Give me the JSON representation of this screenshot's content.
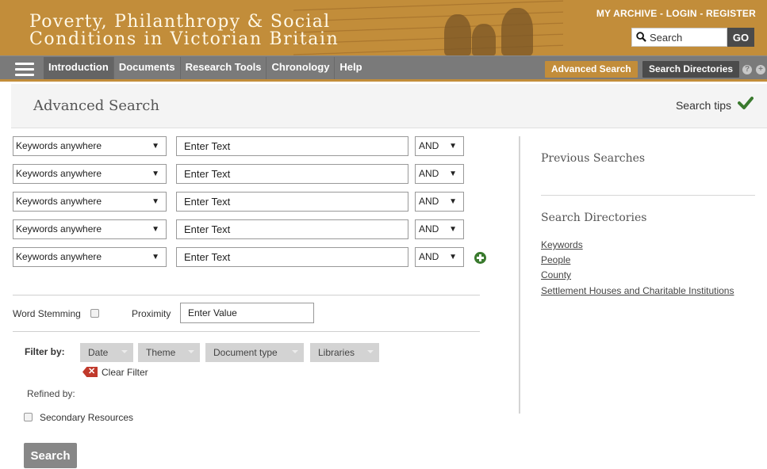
{
  "header": {
    "title_line1": "Poverty, Philanthropy & Social",
    "title_line2": "Conditions in Victorian Britain",
    "top_links": {
      "my_archive": "MY ARCHIVE",
      "login": "LOGIN",
      "register": "REGISTER",
      "separator": " - "
    },
    "search_placeholder": "Search",
    "go_label": "GO"
  },
  "nav": {
    "items": [
      {
        "label": "Introduction"
      },
      {
        "label": "Documents"
      },
      {
        "label": "Research Tools"
      },
      {
        "label": "Chronology"
      },
      {
        "label": "Help"
      }
    ],
    "advanced_search": "Advanced Search",
    "search_directories": "Search Directories",
    "help_icon_glyph": "?",
    "add_icon_glyph": "+"
  },
  "page": {
    "title": "Advanced Search",
    "search_tips": "Search tips"
  },
  "search_rows": [
    {
      "field": "Keywords anywhere",
      "placeholder": "Enter Text",
      "operator": "AND"
    },
    {
      "field": "Keywords anywhere",
      "placeholder": "Enter Text",
      "operator": "AND"
    },
    {
      "field": "Keywords anywhere",
      "placeholder": "Enter Text",
      "operator": "AND"
    },
    {
      "field": "Keywords anywhere",
      "placeholder": "Enter Text",
      "operator": "AND"
    },
    {
      "field": "Keywords anywhere",
      "placeholder": "Enter Text",
      "operator": "AND"
    }
  ],
  "dropdown_arrow": "▼",
  "options": {
    "word_stemming": "Word Stemming",
    "proximity": "Proximity",
    "proximity_placeholder": "Enter Value"
  },
  "filter": {
    "label": "Filter by:",
    "buttons": [
      {
        "label": "Date"
      },
      {
        "label": "Theme"
      },
      {
        "label": "Document type"
      },
      {
        "label": "Libraries"
      }
    ],
    "clear_glyph": "✕",
    "clear_label": "Clear Filter",
    "refined_by": "Refined by:",
    "secondary_resources": "Secondary Resources"
  },
  "submit_label": "Search",
  "sidebar": {
    "previous_searches": "Previous Searches",
    "search_directories": "Search Directories",
    "links": [
      {
        "label": "Keywords"
      },
      {
        "label": "People"
      },
      {
        "label": "County"
      },
      {
        "label": "Settlement Houses and Charitable Institutions"
      }
    ]
  },
  "colors": {
    "banner": "#c28d3a",
    "nav": "#7a7a7a",
    "search_tips_check": "#3a7a2e",
    "clear_filter": "#c0392b"
  }
}
